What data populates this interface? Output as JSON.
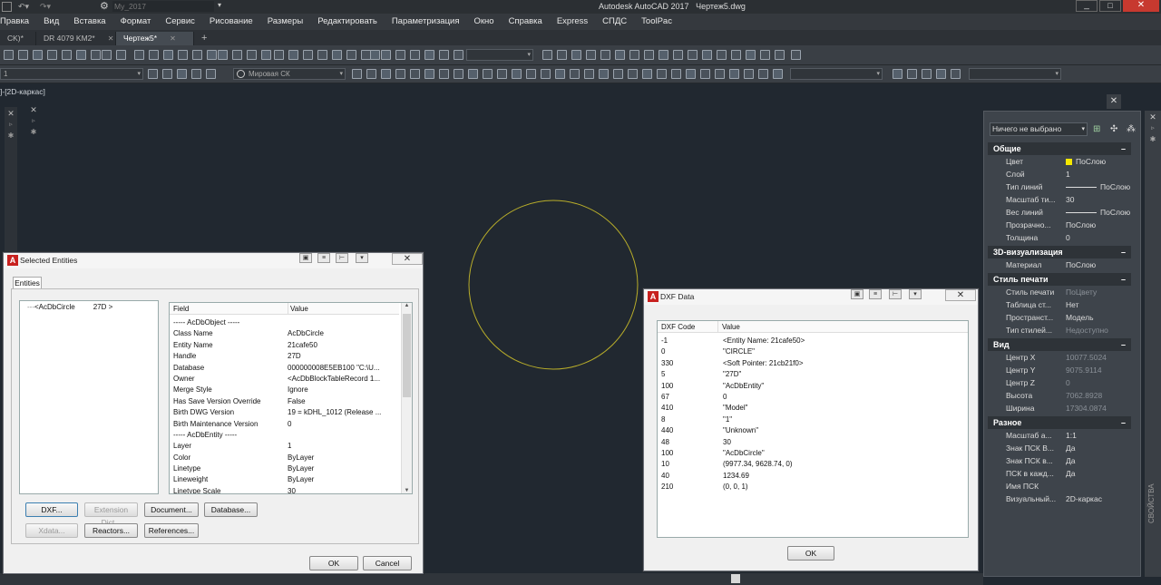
{
  "window": {
    "app_title": "Autodesk AutoCAD 2017",
    "file_title": "Чертеж5.dwg",
    "workspace": "My_2017"
  },
  "menu": [
    "Правка",
    "Вид",
    "Вставка",
    "Формат",
    "Сервис",
    "Рисование",
    "Размеры",
    "Редактировать",
    "Параметризация",
    "Окно",
    "Справка",
    "Express",
    "СПДС",
    "ToolPac"
  ],
  "tabs": [
    {
      "label": "CK)*",
      "active": false
    },
    {
      "label": "DR 4079 KM2*",
      "active": false
    },
    {
      "label": "Чертеж5*",
      "active": true
    }
  ],
  "toolbar": {
    "layer_combo": "1",
    "ucs_combo": "Мировая СК"
  },
  "viewport": {
    "label": "]-[2D-каркас]"
  },
  "selected_entities": {
    "title": "Selected Entities",
    "tab": "Entities",
    "tree_item": "<AcDbCircle",
    "tree_handle": "27D >",
    "columns": {
      "field": "Field",
      "value": "Value"
    },
    "rows": [
      {
        "f": "----- AcDbObject -----",
        "v": ""
      },
      {
        "f": "Class Name",
        "v": "AcDbCircle"
      },
      {
        "f": "Entity Name",
        "v": "21cafe50"
      },
      {
        "f": "Handle",
        "v": "27D"
      },
      {
        "f": "Database",
        "v": "000000008E5EB100  \"C:\\U..."
      },
      {
        "f": "Owner",
        "v": "<AcDbBlockTableRecord 1..."
      },
      {
        "f": "Merge Style",
        "v": "Ignore"
      },
      {
        "f": "Has Save Version Override",
        "v": "False"
      },
      {
        "f": "Birth DWG Version",
        "v": "19 = kDHL_1012  (Release ..."
      },
      {
        "f": "Birth Maintenance Version",
        "v": "0"
      },
      {
        "f": "----- AcDbEntity -----",
        "v": ""
      },
      {
        "f": "Layer",
        "v": "1"
      },
      {
        "f": "Color",
        "v": "ByLayer"
      },
      {
        "f": "Linetype",
        "v": "ByLayer"
      },
      {
        "f": "Lineweight",
        "v": "ByLayer"
      },
      {
        "f": "Linetype Scale",
        "v": "30"
      }
    ],
    "buttons": {
      "dxf": "DXF...",
      "extension_dict": "Extension Dict...",
      "document": "Document...",
      "database": "Database...",
      "xdata": "Xdata...",
      "reactors": "Reactors...",
      "references": "References...",
      "ok": "OK",
      "cancel": "Cancel"
    }
  },
  "dxf_data": {
    "title": "DXF Data",
    "columns": {
      "code": "DXF Code",
      "value": "Value"
    },
    "rows": [
      {
        "c": "-1",
        "v": "<Entity Name: 21cafe50>"
      },
      {
        "c": "0",
        "v": "\"CIRCLE\""
      },
      {
        "c": "330",
        "v": "<Soft Pointer: 21cb21f0>"
      },
      {
        "c": "5",
        "v": "\"27D\""
      },
      {
        "c": "100",
        "v": "\"AcDbEntity\""
      },
      {
        "c": "67",
        "v": "0"
      },
      {
        "c": "410",
        "v": "\"Model\""
      },
      {
        "c": "8",
        "v": "\"1\""
      },
      {
        "c": "440",
        "v": "\"Unknown\""
      },
      {
        "c": "48",
        "v": "30"
      },
      {
        "c": "100",
        "v": "\"AcDbCircle\""
      },
      {
        "c": "10",
        "v": "(9977.34, 9628.74, 0)"
      },
      {
        "c": "40",
        "v": "1234.69"
      },
      {
        "c": "210",
        "v": "(0, 0, 1)"
      }
    ],
    "ok": "OK"
  },
  "properties": {
    "selection": "Ничего не выбрано",
    "side_label": "СВОЙСТВА",
    "sections": [
      {
        "title": "Общие",
        "rows": [
          {
            "k": "Цвет",
            "v": "ПоСлою",
            "swatch": "#f5e800"
          },
          {
            "k": "Слой",
            "v": "1"
          },
          {
            "k": "Тип линий",
            "v": "ПоСлою",
            "line": true
          },
          {
            "k": "Масштаб ти...",
            "v": "30"
          },
          {
            "k": "Вес линий",
            "v": "ПоСлою",
            "line": true
          },
          {
            "k": "Прозрачно...",
            "v": "ПоСлою"
          },
          {
            "k": "Толщина",
            "v": "0"
          }
        ]
      },
      {
        "title": "3D-визуализация",
        "rows": [
          {
            "k": "Материал",
            "v": "ПоСлою"
          }
        ]
      },
      {
        "title": "Стиль печати",
        "rows": [
          {
            "k": "Стиль печати",
            "v": "ПоЦвету",
            "dim": true
          },
          {
            "k": "Таблица ст...",
            "v": "Нет"
          },
          {
            "k": "Пространст...",
            "v": "Модель"
          },
          {
            "k": "Тип стилей...",
            "v": "Недоступно",
            "dim": true
          }
        ]
      },
      {
        "title": "Вид",
        "rows": [
          {
            "k": "Центр X",
            "v": "10077.5024",
            "dim": true
          },
          {
            "k": "Центр Y",
            "v": "9075.9114",
            "dim": true
          },
          {
            "k": "Центр Z",
            "v": "0",
            "dim": true
          },
          {
            "k": "Высота",
            "v": "7062.8928",
            "dim": true
          },
          {
            "k": "Ширина",
            "v": "17304.0874",
            "dim": true
          }
        ]
      },
      {
        "title": "Разное",
        "rows": [
          {
            "k": "Масштаб а...",
            "v": "1:1"
          },
          {
            "k": "Знак ПСК В...",
            "v": "Да"
          },
          {
            "k": "Знак ПСК в...",
            "v": "Да"
          },
          {
            "k": "ПСК в кажд...",
            "v": "Да"
          },
          {
            "k": "Имя ПСК",
            "v": ""
          },
          {
            "k": "Визуальный...",
            "v": "2D-каркас"
          }
        ]
      }
    ]
  },
  "colors": {
    "canvas": "#212830",
    "circle": "#b8ad2a",
    "autodesk_red": "#c8211f"
  }
}
